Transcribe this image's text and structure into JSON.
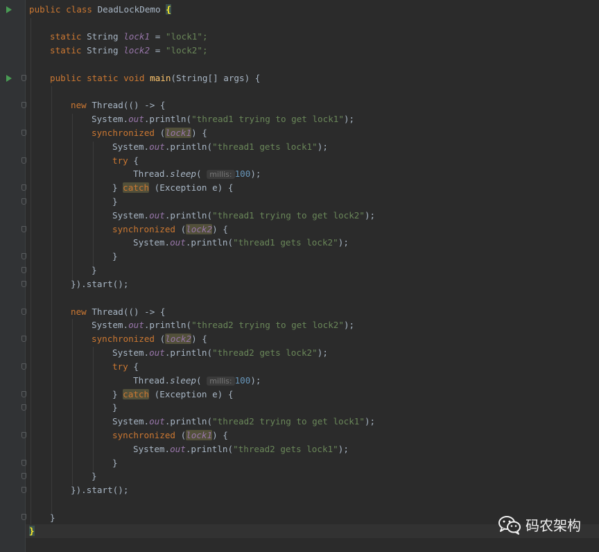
{
  "code": {
    "class_open_kw": "public class",
    "class_name": "DeadLockDemo",
    "open_brace": "{",
    "close_brace": "}",
    "field1": {
      "kw": "static",
      "type": "String",
      "name": "lock1",
      "eq": "=",
      "value": "\"lock1\";"
    },
    "field2": {
      "kw": "static",
      "type": "String",
      "name": "lock2",
      "eq": "=",
      "value": "\"lock2\";"
    },
    "main": {
      "kw": "public static void",
      "name": "main",
      "params": "(String[] args) {"
    },
    "threads": [
      {
        "new_kw": "new",
        "thread_open": "Thread(() -> {",
        "msg_try_first": "\"thread1 trying to get lock1\"",
        "first_lock": "lock1",
        "msg_gets_first": "\"thread1 gets lock1\"",
        "sleep_hint": "millis:",
        "sleep_value": "100",
        "msg_try_second": "\"thread1 trying to get lock2\"",
        "second_lock": "lock2",
        "msg_gets_second": "\"thread1 gets lock2\"",
        "close": "}).start();"
      },
      {
        "new_kw": "new",
        "thread_open": "Thread(() -> {",
        "msg_try_first": "\"thread2 trying to get lock2\"",
        "first_lock": "lock2",
        "msg_gets_first": "\"thread2 gets lock2\"",
        "sleep_hint": "millis:",
        "sleep_value": "100",
        "msg_try_second": "\"thread2 trying to get lock1\"",
        "second_lock": "lock1",
        "msg_gets_second": "\"thread2 gets lock1\"",
        "close": "}).start();"
      }
    ],
    "tokens": {
      "system": "System.",
      "out": "out",
      "println": ".println(",
      "end": ");",
      "synchronized": "synchronized",
      "paren_open": "(",
      "paren_close_brace": ") {",
      "try_kw": "try",
      "brace": "{",
      "close": "}",
      "thread_sleep": "Thread.",
      "sleep": "sleep",
      "sleep_open": "(",
      "catch_open": "} ",
      "catch_kw": "catch",
      "catch_rest": " (Exception e) {"
    }
  },
  "watermark": {
    "text": "码农架构",
    "icon": "wechat-icon"
  },
  "colors": {
    "background": "#2b2b2b",
    "keyword": "#cc7832",
    "string": "#6a8759",
    "field": "#9876aa",
    "method": "#ffc66d",
    "number": "#6897bb",
    "run": "#499c54"
  }
}
